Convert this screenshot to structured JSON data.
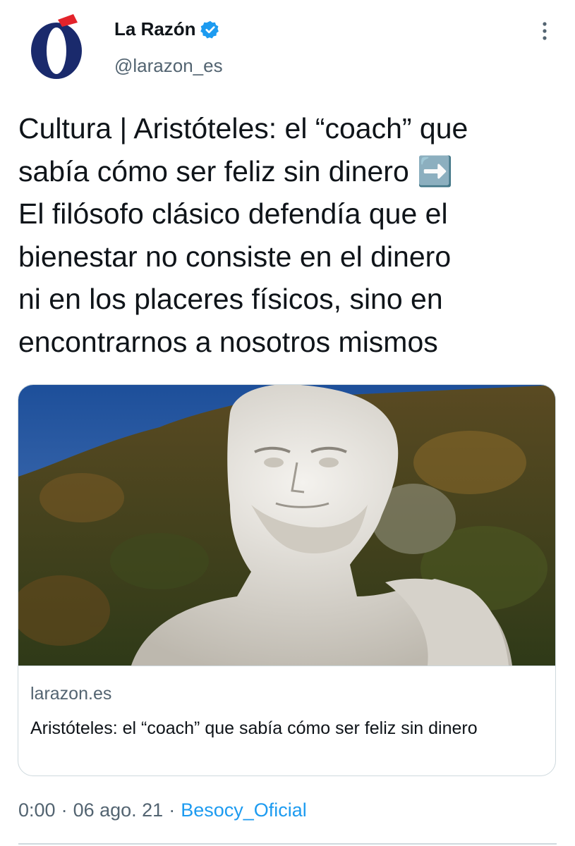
{
  "account": {
    "display_name": "La Razón",
    "handle": "@larazon_es",
    "verified": true,
    "logo_letter": "Ó"
  },
  "tweet": {
    "text": "Cultura | Aristóteles: el “coach” que\nsabía cómo ser feliz sin dinero ➡️\nEl filósofo clásico defendía que el\nbienestar no consiste en el dinero\nni en los placeres físicos, sino en\nencontrarnos a nosotros mismos"
  },
  "card": {
    "image_icon": "aristotle-statue-image",
    "domain": "larazon.es",
    "title": "Aristóteles: el “coach” que sabía cómo ser feliz sin dinero"
  },
  "meta": {
    "time": "0:00",
    "separator": "·",
    "date": "06 ago. 21",
    "source": "Besocy_Oficial"
  },
  "colors": {
    "text_primary": "#0f1419",
    "text_secondary": "#536471",
    "link": "#1d9bf0",
    "verified": "#1d9bf0",
    "logo_blue": "#1a2a6c",
    "logo_red": "#e3232b",
    "border": "#cfd9de"
  },
  "icons": {
    "verified": "verified-badge-icon",
    "more": "more-options-icon"
  }
}
